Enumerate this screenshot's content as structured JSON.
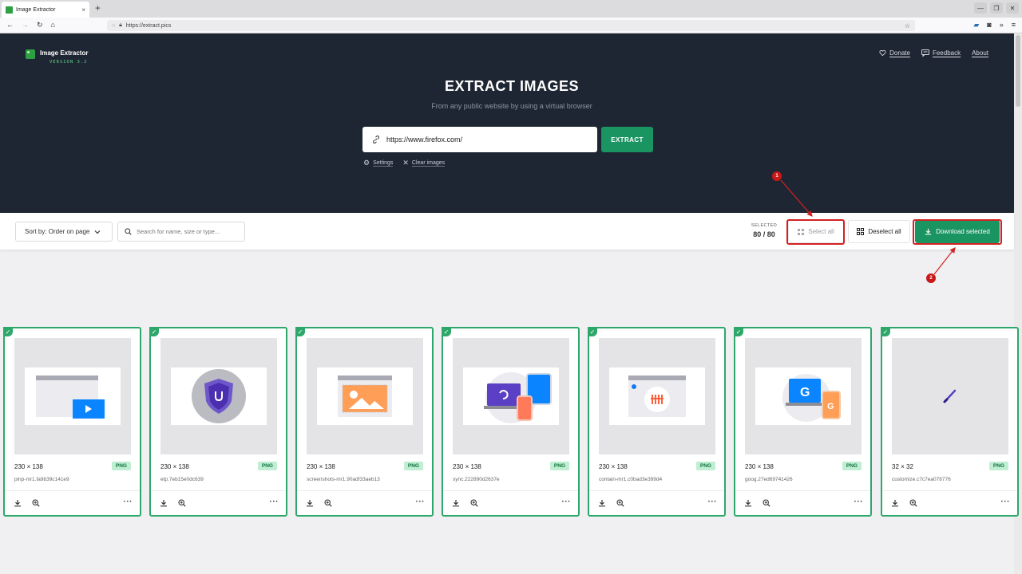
{
  "browser": {
    "tab_title": "Image Extractor",
    "tab_close": "×",
    "new_tab": "+",
    "url": "https://extract.pics",
    "window_controls": [
      "—",
      "❐",
      "✕"
    ]
  },
  "app": {
    "name": "Image Extractor",
    "version": "VERSION 3.2",
    "nav": {
      "donate": "Donate",
      "feedback": "Feedback",
      "about": "About"
    },
    "hero_title": "EXTRACT IMAGES",
    "hero_subtitle": "From any public website by using a virtual browser",
    "url_value": "https://www.firefox.com/",
    "extract_label": "EXTRACT",
    "settings_label": "Settings",
    "clear_label": "Clear images"
  },
  "toolbar": {
    "sort_label": "Sort by: Order on page",
    "search_placeholder": "Search for name, size or type...",
    "selected_label": "SELECTED",
    "selected_count": "80 / 80",
    "select_all": "Select all",
    "deselect_all": "Deselect all",
    "download_selected": "Download selected"
  },
  "annotations": {
    "one": "1",
    "two": "2",
    "accent": "#d42020"
  },
  "colors": {
    "hero_bg": "#1f2633",
    "accent_green": "#1a9461",
    "card_border": "#2ea86a"
  },
  "images": [
    {
      "dims": "230 × 138",
      "type": "PNG",
      "name": "pinp-mr1.fa9b39c141e9",
      "icon": "pip-video-illustration"
    },
    {
      "dims": "230 × 138",
      "type": "PNG",
      "name": "etp.7eb15e0dc639",
      "icon": "shield-illustration"
    },
    {
      "dims": "230 × 138",
      "type": "PNG",
      "name": "screenshots-mr1.90adf33aeb13",
      "icon": "screenshot-illustration"
    },
    {
      "dims": "230 × 138",
      "type": "PNG",
      "name": "sync.222890d2637e",
      "icon": "sync-devices-illustration"
    },
    {
      "dims": "230 × 138",
      "type": "PNG",
      "name": "contain-mr1.c0bad3e399d4",
      "icon": "facebook-container-illustration"
    },
    {
      "dims": "230 × 138",
      "type": "PNG",
      "name": "goog.27ed69741426",
      "icon": "google-devices-illustration"
    },
    {
      "dims": "32 × 32",
      "type": "PNG",
      "name": "customize.c7c7ea078776",
      "icon": "brush-icon"
    }
  ]
}
